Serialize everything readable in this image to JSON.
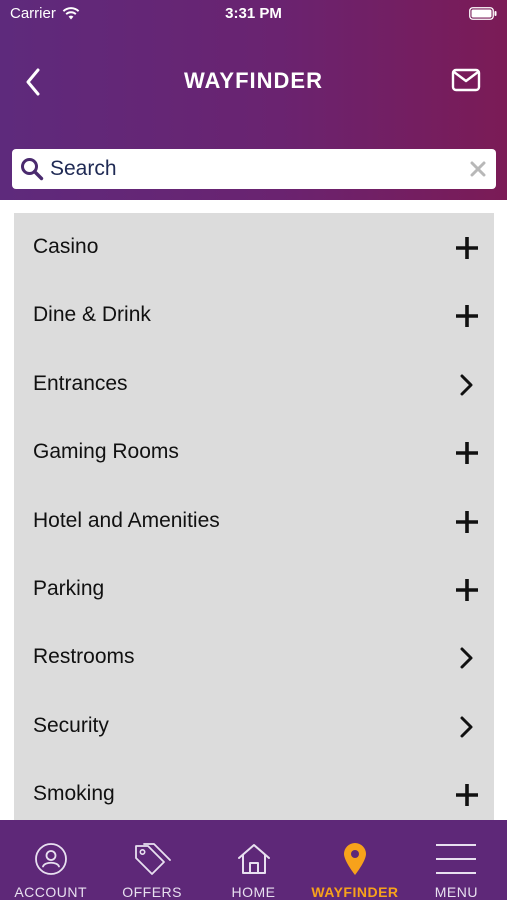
{
  "status_bar": {
    "carrier": "Carrier",
    "time": "3:31 PM"
  },
  "nav": {
    "title": "WAYFINDER",
    "back_icon": "chevron-left-icon",
    "mail_icon": "envelope-icon"
  },
  "search": {
    "placeholder": "Search",
    "value": ""
  },
  "categories": [
    {
      "label": "Casino",
      "action": "expand"
    },
    {
      "label": "Dine & Drink",
      "action": "expand"
    },
    {
      "label": "Entrances",
      "action": "navigate"
    },
    {
      "label": "Gaming Rooms",
      "action": "expand"
    },
    {
      "label": "Hotel and Amenities",
      "action": "expand"
    },
    {
      "label": "Parking",
      "action": "expand"
    },
    {
      "label": "Restrooms",
      "action": "navigate"
    },
    {
      "label": "Security",
      "action": "navigate"
    },
    {
      "label": "Smoking",
      "action": "expand"
    }
  ],
  "tabs": [
    {
      "label": "ACCOUNT",
      "icon": "account-icon",
      "active": false
    },
    {
      "label": "OFFERS",
      "icon": "tags-icon",
      "active": false
    },
    {
      "label": "HOME",
      "icon": "home-icon",
      "active": false
    },
    {
      "label": "WAYFINDER",
      "icon": "map-pin-icon",
      "active": true
    },
    {
      "label": "MENU",
      "icon": "hamburger-menu-icon",
      "active": false
    }
  ],
  "colors": {
    "header_start": "#5e2a7c",
    "header_end": "#7b1b56",
    "tab_bar": "#5e2878",
    "active_tab": "#f7a21b",
    "list_background": "#dcdcdc"
  }
}
